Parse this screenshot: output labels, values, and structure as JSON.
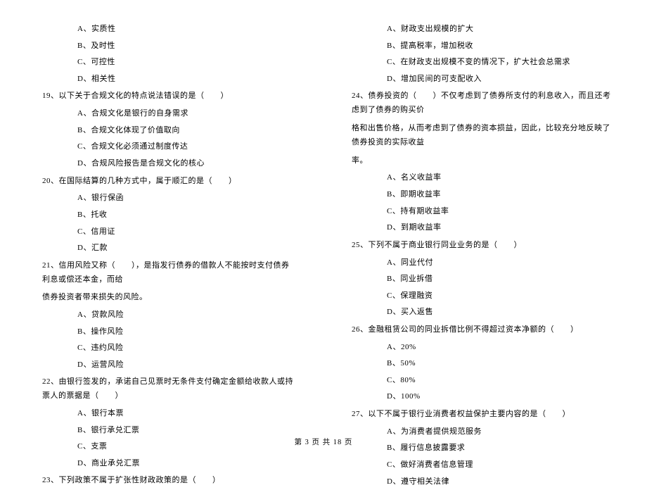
{
  "left": {
    "q18_options": {
      "a": "A、实质性",
      "b": "B、及时性",
      "c": "C、可控性",
      "d": "D、相关性"
    },
    "q19": {
      "text": "19、以下关于合规文化的特点说法错误的是（　　）",
      "a": "A、合规文化是银行的自身需求",
      "b": "B、合规文化体现了价值取向",
      "c": "C、合规文化必须通过制度传达",
      "d": "D、合规风险报告是合规文化的核心"
    },
    "q20": {
      "text": "20、在国际结算的几种方式中，属于顺汇的是（　　）",
      "a": "A、银行保函",
      "b": "B、托收",
      "c": "C、信用证",
      "d": "D、汇款"
    },
    "q21": {
      "text1": "21、信用风险又称（　　），是指发行债券的借款人不能按时支付债券利息或偿还本金，而给",
      "text2": "债券投资者带来损失的风险。",
      "a": "A、贷款风险",
      "b": "B、操作风险",
      "c": "C、违约风险",
      "d": "D、运营风险"
    },
    "q22": {
      "text": "22、由银行签发的，承诺自己见票时无条件支付确定金额给收款人或持票人的票据是（　　）",
      "a": "A、银行本票",
      "b": "B、银行承兑汇票",
      "c": "C、支票",
      "d": "D、商业承兑汇票"
    },
    "q23": {
      "text": "23、下列政策不属于扩张性财政政策的是（　　）"
    }
  },
  "right": {
    "q23_options": {
      "a": "A、财政支出规模的扩大",
      "b": "B、提高税率，增加税收",
      "c": "C、在财政支出规模不变的情况下，扩大社会总需求",
      "d": "D、增加民间的可支配收入"
    },
    "q24": {
      "text1": "24、债券投资的（　　）不仅考虑到了债券所支付的利息收入，而且还考虑到了债券的购买价",
      "text2": "格和出售价格，从而考虑到了债券的资本损益，因此，比较充分地反映了债券投资的实际收益",
      "text3": "率。",
      "a": "A、名义收益率",
      "b": "B、即期收益率",
      "c": "C、持有期收益率",
      "d": "D、到期收益率"
    },
    "q25": {
      "text": "25、下列不属于商业银行同业业务的是（　　）",
      "a": "A、同业代付",
      "b": "B、同业拆借",
      "c": "C、保理融资",
      "d": "D、买入返售"
    },
    "q26": {
      "text": "26、金融租赁公司的同业拆借比例不得超过资本净额的（　　）",
      "a": "A、20%",
      "b": "B、50%",
      "c": "C、80%",
      "d": "D、100%"
    },
    "q27": {
      "text": "27、以下不属于银行业消费者权益保护主要内容的是（　　）",
      "a": "A、为消费者提供规范服务",
      "b": "B、履行信息披露要求",
      "c": "C、做好消费者信息管理",
      "d": "D、遵守相关法律"
    }
  },
  "footer": "第 3 页 共 18 页"
}
